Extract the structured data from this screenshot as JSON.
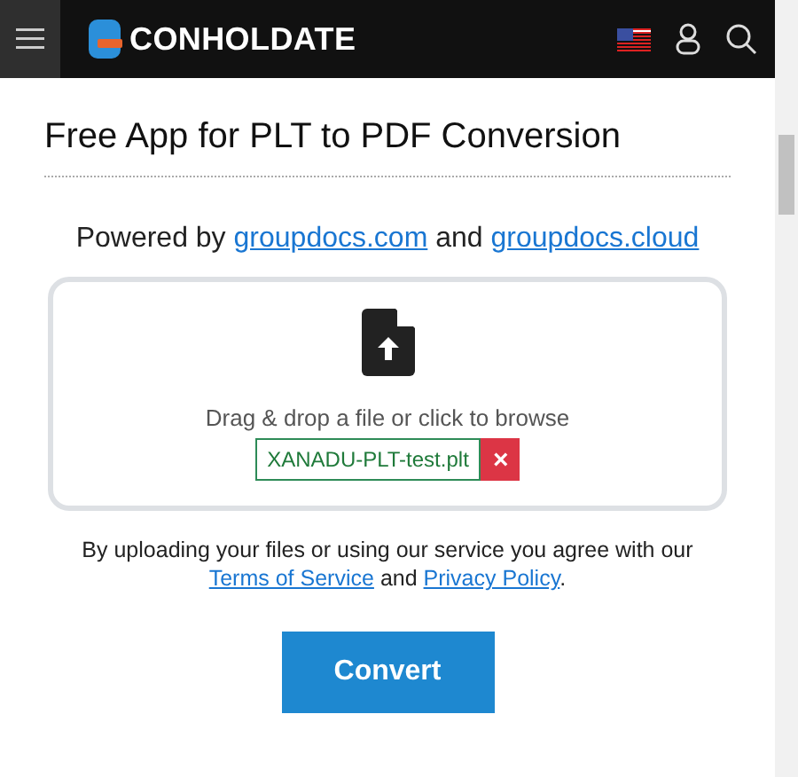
{
  "header": {
    "logo_text": "CONHOLDATE"
  },
  "title": "Free App for PLT to PDF Conversion",
  "powered_by": {
    "prefix": "Powered by",
    "link_1": "groupdocs.com",
    "joiner": "and",
    "link_2": "groupdocs.cloud"
  },
  "dropzone": {
    "hint": "Drag & drop a file or click to browse",
    "file": {
      "name": "XANADU-PLT-test.plt",
      "remove": "×"
    }
  },
  "consent": {
    "text": "By uploading your files or using our service you agree with our",
    "link_1": "Terms of Service",
    "joiner": "and",
    "link_2": "Privacy Policy",
    "end": "."
  },
  "buttons": [
    {
      "label": "Convert",
      "kind": "primary"
    }
  ]
}
